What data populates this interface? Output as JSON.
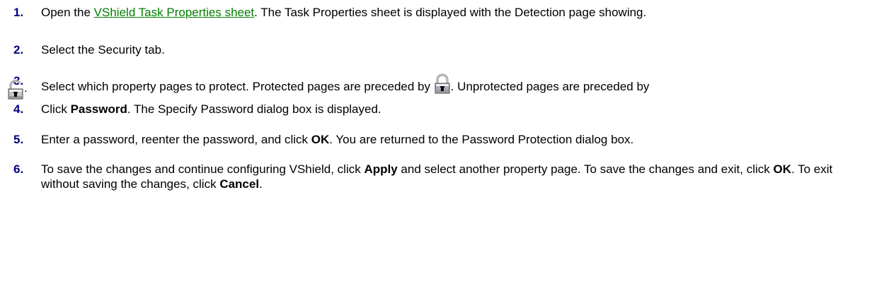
{
  "colors": {
    "step_number": "#000080",
    "link": "#008000",
    "text": "#000000",
    "background": "#ffffff"
  },
  "steps": [
    {
      "number": "1.",
      "link_text": "VShield Task Properties sheet",
      "before": "Open the ",
      "after": ". The Task Properties sheet is displayed with the Detection page showing."
    },
    {
      "number": "2.",
      "text": "Select the Security tab."
    },
    {
      "number": "3.",
      "part1": "Select which property pages to protect. Protected pages are preceded by ",
      "icon_protected": "closed-padlock-icon",
      "part2": ". Unprotected pages are preceded by",
      "icon_unprotected": "open-padlock-icon",
      "part3": "."
    },
    {
      "number": "4.",
      "p1": "Click ",
      "b1": "Password",
      "p2": ". The Specify Password dialog box is displayed."
    },
    {
      "number": "5.",
      "p1": "Enter a password, reenter the password, and click ",
      "b1": "OK",
      "p2": ". You are returned to the Password Protection dialog box."
    },
    {
      "number": "6.",
      "p1": "To save the changes and continue configuring VShield, click ",
      "b1": "Apply",
      "p2": " and select another property page. To save the changes and exit, click ",
      "b2": "OK",
      "p3": ". To exit without saving the changes, click ",
      "b3": "Cancel",
      "p4": "."
    }
  ]
}
